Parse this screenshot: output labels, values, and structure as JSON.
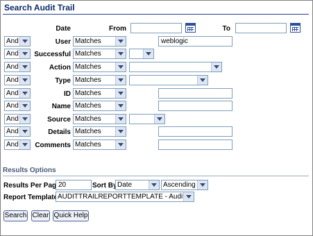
{
  "title": "Search Audit Trail",
  "date_row": {
    "label": "Date",
    "from_label": "From",
    "from_value": "",
    "to_label": "To",
    "to_value": ""
  },
  "rows": [
    {
      "conjunction": "And",
      "label": "User",
      "operator": "Matches",
      "value": "weblogic"
    },
    {
      "conjunction": "And",
      "label": "Successful",
      "operator": "Matches",
      "value": ""
    },
    {
      "conjunction": "And",
      "label": "Action",
      "operator": "Matches",
      "value": ""
    },
    {
      "conjunction": "And",
      "label": "Type",
      "operator": "Matches",
      "value": ""
    },
    {
      "conjunction": "And",
      "label": "ID",
      "operator": "Matches",
      "value": ""
    },
    {
      "conjunction": "And",
      "label": "Name",
      "operator": "Matches",
      "value": ""
    },
    {
      "conjunction": "And",
      "label": "Source",
      "operator": "Matches",
      "value": ""
    },
    {
      "conjunction": "And",
      "label": "Details",
      "operator": "Matches",
      "value": ""
    },
    {
      "conjunction": "And",
      "label": "Comments",
      "operator": "Matches",
      "value": ""
    }
  ],
  "results": {
    "section_label": "Results Options",
    "per_page_label": "Results Per Page:",
    "per_page_value": "20",
    "sort_by_label": "Sort By:",
    "sort_by_value": "Date",
    "sort_order_value": "Ascending",
    "report_template_label": "Report Template",
    "report_template_value": "AUDITTRAILREPORTTEMPLATE - Audit Trail"
  },
  "buttons": {
    "search": "Search",
    "clear": "Clear",
    "quick_help": "Quick Help"
  },
  "colors": {
    "title": "#0a2a66",
    "border": "#7f9db9",
    "accent": "#2b4f9a"
  }
}
